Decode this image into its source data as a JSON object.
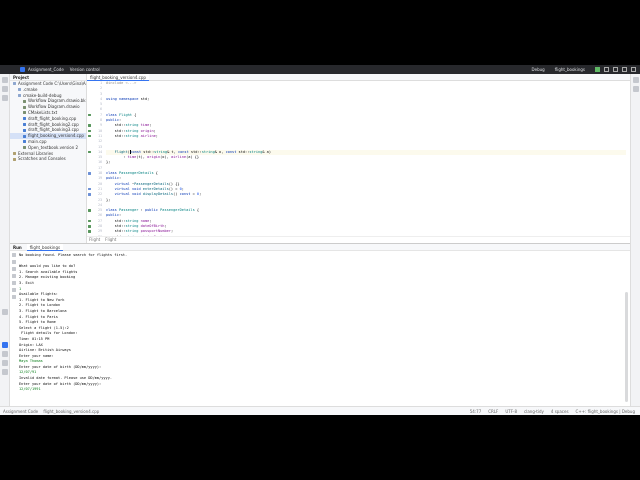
{
  "titlebar": {
    "project": "Assignment_Code",
    "vcs": "Version control",
    "config": "Debug",
    "run_target": "flight_bookings"
  },
  "project_panel": {
    "title": "Project",
    "items": [
      {
        "label": "Assignment Code  C:\\Users\\Gina\\Assignment_Code",
        "depth": 0,
        "icon": "folder-icon"
      },
      {
        "label": ".cmake",
        "depth": 1,
        "icon": "folder-icon"
      },
      {
        "label": "cmake-build-debug",
        "depth": 1,
        "icon": "folder-icon"
      },
      {
        "label": "Workflow Diagram.drawio.bkp",
        "depth": 2,
        "icon": "file-icon"
      },
      {
        "label": "Workflow Diagram.drawio",
        "depth": 2,
        "icon": "file-icon"
      },
      {
        "label": "CMakeLists.txt",
        "depth": 2,
        "icon": "file-icon"
      },
      {
        "label": "draft_flight_booking.cpp",
        "depth": 2,
        "icon": "cpp-icon"
      },
      {
        "label": "draft_flight_booking2.cpp",
        "depth": 2,
        "icon": "cpp-icon"
      },
      {
        "label": "draft_flight_booking3.cpp",
        "depth": 2,
        "icon": "cpp-icon"
      },
      {
        "label": "flight_booking_version4.cpp",
        "depth": 2,
        "icon": "cpp-icon"
      },
      {
        "label": "main.cpp",
        "depth": 2,
        "icon": "cpp-icon"
      },
      {
        "label": "Open_textbook.version 2",
        "depth": 2,
        "icon": "file-icon"
      },
      {
        "label": "External Libraries",
        "depth": 0,
        "icon": "library-icon"
      },
      {
        "label": "Scratches and Consoles",
        "depth": 0,
        "icon": "library-icon"
      }
    ]
  },
  "editor": {
    "tab": "flight_booking_version4.cpp",
    "breadcrumb": [
      "Flight",
      "Flight"
    ]
  },
  "run_panel": {
    "label": "Run",
    "tab": "flight_bookings"
  },
  "console_lines": [
    {
      "text": "No booking found. Please search for flights first.",
      "input": false
    },
    {
      "text": "",
      "input": false
    },
    {
      "text": "What would you like to do?",
      "input": false
    },
    {
      "text": "1. Search available flights",
      "input": false
    },
    {
      "text": "2. Manage existing booking",
      "input": false
    },
    {
      "text": "3. Exit",
      "input": false
    },
    {
      "text": "1",
      "input": true
    },
    {
      "text": "Available Flights:",
      "input": false
    },
    {
      "text": "1. Flight to New York",
      "input": false
    },
    {
      "text": "2. Flight to London",
      "input": false
    },
    {
      "text": "3. Flight to Barcelona",
      "input": false
    },
    {
      "text": "4. Flight to Paris",
      "input": false
    },
    {
      "text": "5. Flight to Rome",
      "input": false
    },
    {
      "text": "Select a flight (1-5):2",
      "input": false
    },
    {
      "text": " Flight details for London:",
      "input": false
    },
    {
      "text": "Time: 01:15 PM",
      "input": false
    },
    {
      "text": "Origin: LAX",
      "input": false
    },
    {
      "text": "Airline: British Airways",
      "input": false
    },
    {
      "text": "Enter your name:",
      "input": false
    },
    {
      "text": "Maya Thomas",
      "input": true
    },
    {
      "text": "Enter your date of birth (DD/mm/yyyy):",
      "input": false
    },
    {
      "text": "12/07/91",
      "input": true
    },
    {
      "text": "Invalid date format. Please use DD/mm/yyyy.",
      "input": false
    },
    {
      "text": "Enter your date of birth (DD/mm/yyyy):",
      "input": false
    },
    {
      "text": "12/07/1991",
      "input": true
    }
  ],
  "statusbar": {
    "path": [
      "Assignment Code",
      "flight_booking_version4.cpp"
    ],
    "position": "54:77",
    "line_sep": "CRLF",
    "encoding": "UTF-8",
    "indent": "clang-tidy",
    "spaces": "4 spaces",
    "context": "C++: flight_bookings | Debug"
  }
}
